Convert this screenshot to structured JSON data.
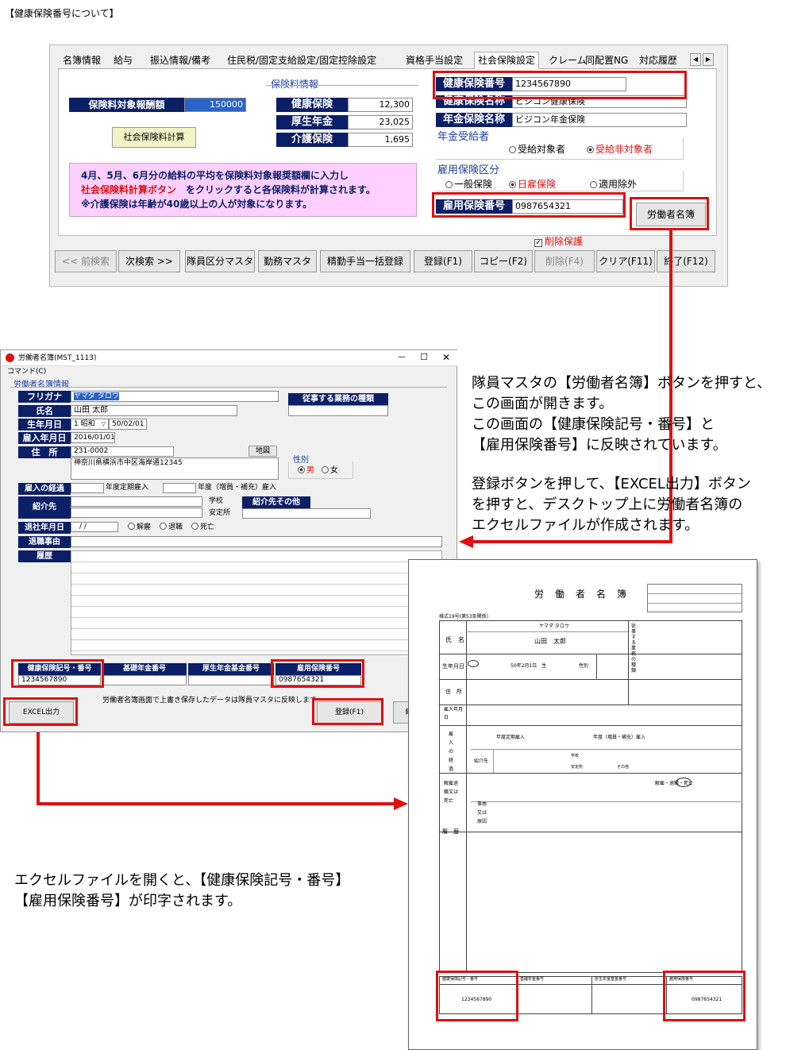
{
  "page_title": "【健康保険番号について】",
  "main": {
    "tabs": [
      "名簿情報",
      "給与",
      "振込情報/備考",
      "住民税/固定支給設定/固定控除設定",
      "資格手当設定",
      "社会保険設定",
      "クレーム",
      "同配置NG",
      "対応履歴"
    ],
    "basis_label": "保険料対象報酬額",
    "basis_value": "150000",
    "calc_button": "社会保険料計算",
    "premium_title": "保険料情報",
    "premiums": [
      {
        "label": "健康保険",
        "value": "12,300"
      },
      {
        "label": "厚生年金",
        "value": "23,025"
      },
      {
        "label": "介護保険",
        "value": "1,695"
      }
    ],
    "note_line1": "4月、5月、6月分の給料の平均を保険料対象報奨額欄に入力し",
    "note_line2a": "社会保険料計算ボタン",
    "note_line2b": "をクリックすると各保険料が計算されます。",
    "note_line3": "※介護保険は年齢が40歳以上の人が対象になります。",
    "health_no_label": "健康保険番号",
    "health_no_value": "1234567890",
    "health_name_label": "健康保険名称",
    "health_name_value": "ビジコン健康保険",
    "pension_name_label": "年金保険名称",
    "pension_name_value": "ビジコン年金保険",
    "pension_recipient_label": "年金受給者",
    "pension_opt1": "受給対象者",
    "pension_opt2": "受給非対象者",
    "employment_label": "雇用保険区分",
    "emp_opt1": "一般保険",
    "emp_opt2": "日雇保険",
    "emp_opt3": "適用除外",
    "emp_no_label": "雇用保険番号",
    "emp_no_value": "0987654321",
    "roster_button": "労働者名簿",
    "delete_protect": "削除保護",
    "bottom_buttons": [
      "<< 前検索",
      "次検索 >>",
      "隊員区分マスタ",
      "勤務マスタ",
      "精勤手当一括登録",
      "登録(F1)",
      "コピー(F2)",
      "削除(F4)",
      "クリア(F11)",
      "終了(F12)"
    ]
  },
  "dialog": {
    "title": "労働者名簿(MST_1113)",
    "menu": "コマンド(C)",
    "section": "労働者名簿情報",
    "furigana_label": "フリガナ",
    "furigana_value": "ヤマダ タロウ",
    "name_label": "氏名",
    "name_value": "山田 太郎",
    "birth_label": "生年月日",
    "birth_era": "1 昭和",
    "birth_value": "50/02/01",
    "hire_label": "雇入年月日",
    "hire_value": "2016/01/01",
    "addr_label": "住　所",
    "zip": "231-0002",
    "addr_value": "神奈川県横浜市中区海岸通12345",
    "map_button": "地図",
    "job_label": "従事する業務の種類",
    "gender_label": "性別",
    "male": "男",
    "female": "女",
    "hire_route_label": "雇入の経過",
    "periodic": "年度定期雇入",
    "midyear": "年度（増員・補充）雇入",
    "referral_label": "紹介先",
    "school": "学校",
    "agency": "安定所",
    "referral_other": "紹介先その他",
    "leave_label": "退社年月日",
    "leave_value": "/  /",
    "dismiss": "解雇",
    "retire": "退職",
    "death": "死亡",
    "reason_label": "退職事由",
    "history_label": "履歴",
    "col_health": "健康保険記号・番号",
    "col_basic": "基礎年金番号",
    "col_welfare": "厚生年金基金番号",
    "col_emp": "雇用保険番号",
    "val_health": "1234567890",
    "val_emp": "0987654321",
    "excel_button": "EXCEL出力",
    "note": "労働者名簿画面で上書き保存したデータは隊員マスタに反映します",
    "register_button": "登録(F1)",
    "end_button": "終"
  },
  "explain": {
    "p1": [
      "隊員マスタの【労働者名簿】ボタンを押すと、",
      "この画面が開きます。",
      "この画面の【健康保険記号・番号】と",
      "【雇用保険番号】に反映されています。"
    ],
    "p2": [
      "登録ボタンを押して、【EXCEL出力】ボタン",
      "を押すと、デスクトップ上に労働者名簿の",
      "エクセルファイルが作成されます。"
    ],
    "p3": [
      "エクセルファイルを開くと、【健康保険記号・番号】",
      "【雇用保険番号】が印字されます。"
    ]
  },
  "paper": {
    "title": "労　働　者　名　簿",
    "form_no": "様式19号(第53条関係)",
    "furigana": "ヤマダ タロウ",
    "name_label": "氏　名",
    "name_value": "山田　太郎",
    "birth_label": "生年月日",
    "birth_value": "50年2月1日　生",
    "gender_label": "性別",
    "job_label": "従事する業務の種類",
    "addr_label": "住　所",
    "hire_label": "雇入年月日",
    "route_label": "雇入の経過",
    "route_text1": "年度定期雇入",
    "route_text2": "年度（増員・補充）雇入",
    "referral": "紹介先",
    "school": "学校",
    "agency": "安定所",
    "other": "その他",
    "leave_label": "解雇退職又は死亡",
    "leave_text": "解雇・退職・死亡",
    "reason": "事由又は原因",
    "history": "履　歴",
    "col_health": "健康保険記号・番号",
    "col_basic": "基礎年金番号",
    "col_welfare": "厚生年金基金番号",
    "col_emp": "雇用保険番号",
    "val_health": "1234567890",
    "val_emp": "0987654321"
  }
}
